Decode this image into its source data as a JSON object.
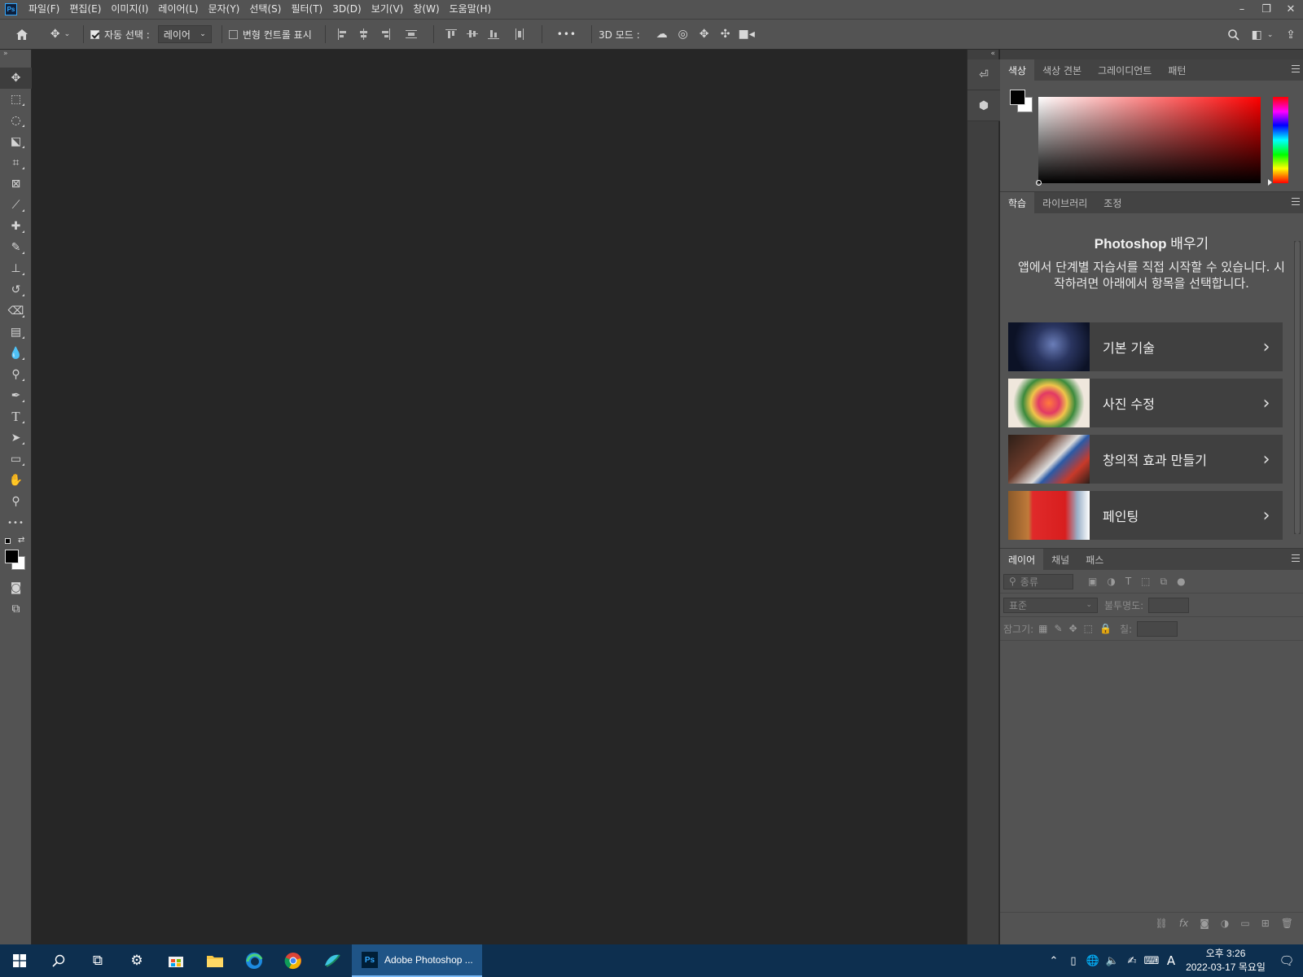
{
  "app": {
    "logo_text": "Ps"
  },
  "menu": [
    "파일(F)",
    "편집(E)",
    "이미지(I)",
    "레이어(L)",
    "문자(Y)",
    "선택(S)",
    "필터(T)",
    "3D(D)",
    "보기(V)",
    "창(W)",
    "도움말(H)"
  ],
  "window_controls": {
    "minimize": "–",
    "restore": "❐",
    "close": "✕"
  },
  "options_bar": {
    "auto_select_label": "자동 선택 :",
    "auto_select_checked": true,
    "auto_select_value": "레이어",
    "transform_label": "변형 컨트롤 표시",
    "transform_checked": false,
    "more": "•••",
    "mode_3d_label": "3D 모드 :"
  },
  "tools": [
    {
      "name": "move-tool",
      "glyph": "✥"
    },
    {
      "name": "marquee-tool",
      "glyph": "⬚"
    },
    {
      "name": "lasso-tool",
      "glyph": "◌"
    },
    {
      "name": "object-select-tool",
      "glyph": "⬕"
    },
    {
      "name": "crop-tool",
      "glyph": "⌗"
    },
    {
      "name": "frame-tool",
      "glyph": "⊠"
    },
    {
      "name": "eyedropper-tool",
      "glyph": "⟋"
    },
    {
      "name": "healing-brush-tool",
      "glyph": "✚"
    },
    {
      "name": "brush-tool",
      "glyph": "✎"
    },
    {
      "name": "clone-stamp-tool",
      "glyph": "⊥"
    },
    {
      "name": "history-brush-tool",
      "glyph": "↺"
    },
    {
      "name": "eraser-tool",
      "glyph": "⌫"
    },
    {
      "name": "gradient-tool",
      "glyph": "▤"
    },
    {
      "name": "blur-tool",
      "glyph": "💧"
    },
    {
      "name": "dodge-tool",
      "glyph": "⚲"
    },
    {
      "name": "pen-tool",
      "glyph": "✒"
    },
    {
      "name": "type-tool",
      "glyph": "T"
    },
    {
      "name": "path-select-tool",
      "glyph": "➤"
    },
    {
      "name": "rectangle-tool",
      "glyph": "▭"
    },
    {
      "name": "hand-tool",
      "glyph": "✋"
    },
    {
      "name": "zoom-tool",
      "glyph": "⚲"
    },
    {
      "name": "edit-toolbar",
      "glyph": "•••"
    }
  ],
  "color_panel": {
    "tabs": [
      "색상",
      "색상 견본",
      "그레이디언트",
      "패턴"
    ],
    "active_tab": 0,
    "foreground": "#000000",
    "background": "#ffffff"
  },
  "learn_panel": {
    "tabs": [
      "학습",
      "라이브러리",
      "조정"
    ],
    "active_tab": 0,
    "title_strong": "Photoshop",
    "title_rest": " 배우기",
    "description": "앱에서 단계별 자습서를 직접 시작할 수 있습니다. 시작하려면 아래에서 항목을 선택합니다.",
    "cards": [
      {
        "label": "기본 기술",
        "thumb": "dark-room"
      },
      {
        "label": "사진 수정",
        "thumb": "flowers"
      },
      {
        "label": "창의적 효과 만들기",
        "thumb": "collage"
      },
      {
        "label": "페인팅",
        "thumb": "fish-painting"
      }
    ]
  },
  "layers_panel": {
    "tabs": [
      "레이어",
      "채널",
      "패스"
    ],
    "active_tab": 0,
    "filter_placeholder": "종류",
    "blend_mode": "표준",
    "opacity_label": "불투명도:",
    "lock_label": "잠그기:",
    "fill_label": "칠:"
  },
  "taskbar": {
    "app_label": "Adobe Photoshop ...",
    "clock_time": "오후 3:26",
    "clock_date": "2022-03-17 목요일",
    "ime": "A"
  }
}
